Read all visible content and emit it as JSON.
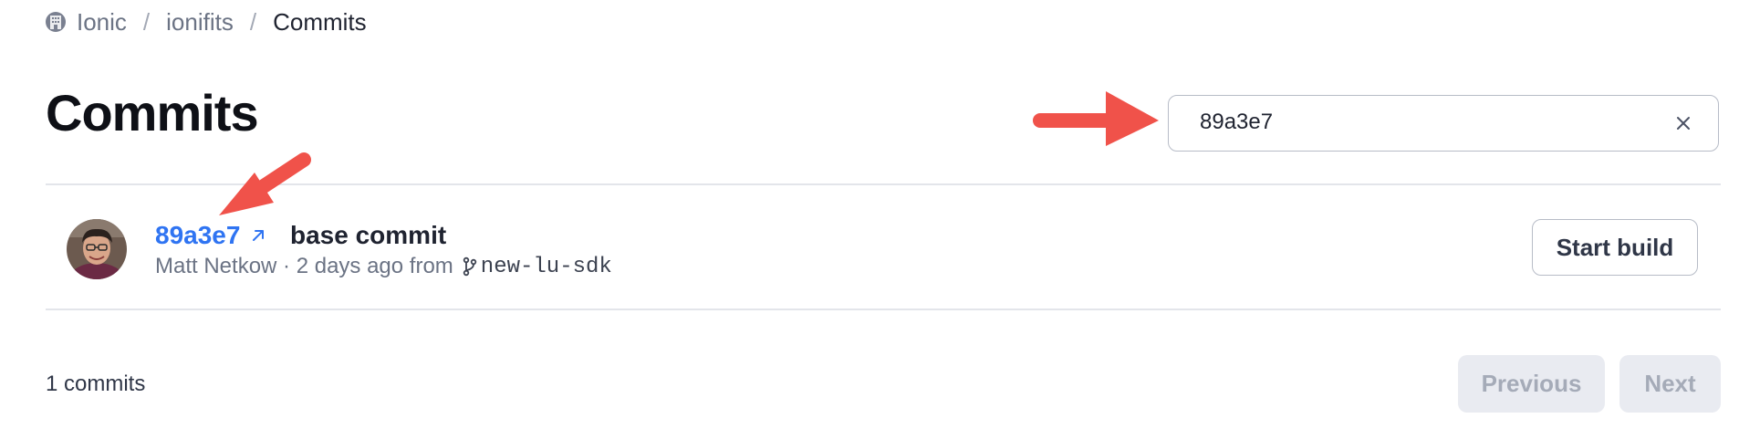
{
  "breadcrumb": {
    "items": [
      {
        "label": "Ionic",
        "icon": "org-icon"
      },
      {
        "label": "ionifits"
      },
      {
        "label": "Commits"
      }
    ],
    "separator": "/"
  },
  "page": {
    "title": "Commits"
  },
  "search": {
    "value": "89a3e7",
    "clear_icon": "close-icon"
  },
  "commits": [
    {
      "hash": "89a3e7",
      "message": "base commit",
      "author": "Matt Netkow",
      "time": "2 days ago",
      "from_label": "from",
      "branch": "new-lu-sdk",
      "action_label": "Start build"
    }
  ],
  "footer": {
    "count_label": "1 commits",
    "previous_label": "Previous",
    "next_label": "Next"
  },
  "colors": {
    "accent": "#2f74f2",
    "annotation": "#f0524a",
    "muted_text": "#6b7384",
    "disabled_bg": "#e9ebf1"
  }
}
